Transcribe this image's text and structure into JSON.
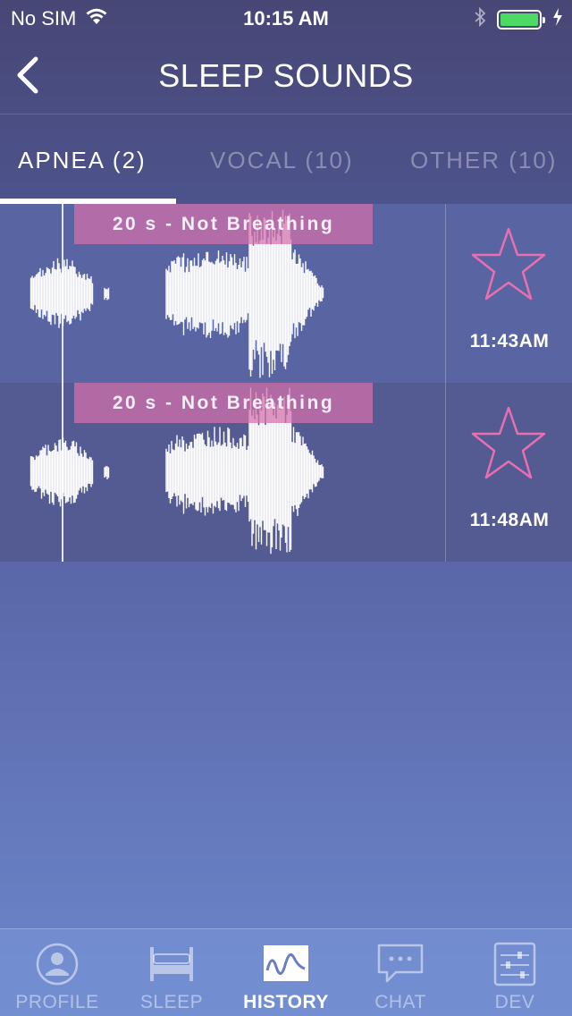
{
  "status_bar": {
    "carrier": "No SIM",
    "time": "10:15 AM",
    "icons": [
      "wifi-icon",
      "bluetooth-icon",
      "battery-icon",
      "charging-bolt-icon"
    ],
    "battery_color": "#4cd964"
  },
  "nav": {
    "title": "SLEEP SOUNDS",
    "back_icon": "chevron-left-icon"
  },
  "tabs": [
    {
      "label": "APNEA (2)",
      "active": true
    },
    {
      "label": "VOCAL (10)",
      "active": false
    },
    {
      "label": "OTHER (10)",
      "active": false
    }
  ],
  "recordings": [
    {
      "event": "20 s - Not Breathing",
      "time": "11:43AM",
      "favorite_icon": "star-outline-icon"
    },
    {
      "event": "20 s - Not Breathing",
      "time": "11:48AM",
      "favorite_icon": "star-outline-icon"
    }
  ],
  "tab_bar": [
    {
      "label": "PROFILE",
      "icon": "profile-icon",
      "active": false
    },
    {
      "label": "SLEEP",
      "icon": "bed-icon",
      "active": false
    },
    {
      "label": "HISTORY",
      "icon": "waveform-icon",
      "active": true
    },
    {
      "label": "CHAT",
      "icon": "chat-bubble-icon",
      "active": false
    },
    {
      "label": "DEV",
      "icon": "sliders-icon",
      "active": false
    }
  ],
  "colors": {
    "accent_pink": "#e96fb0",
    "event_banner": "#d670aa",
    "background_top": "#474776",
    "background_bottom": "#6d87cc"
  }
}
